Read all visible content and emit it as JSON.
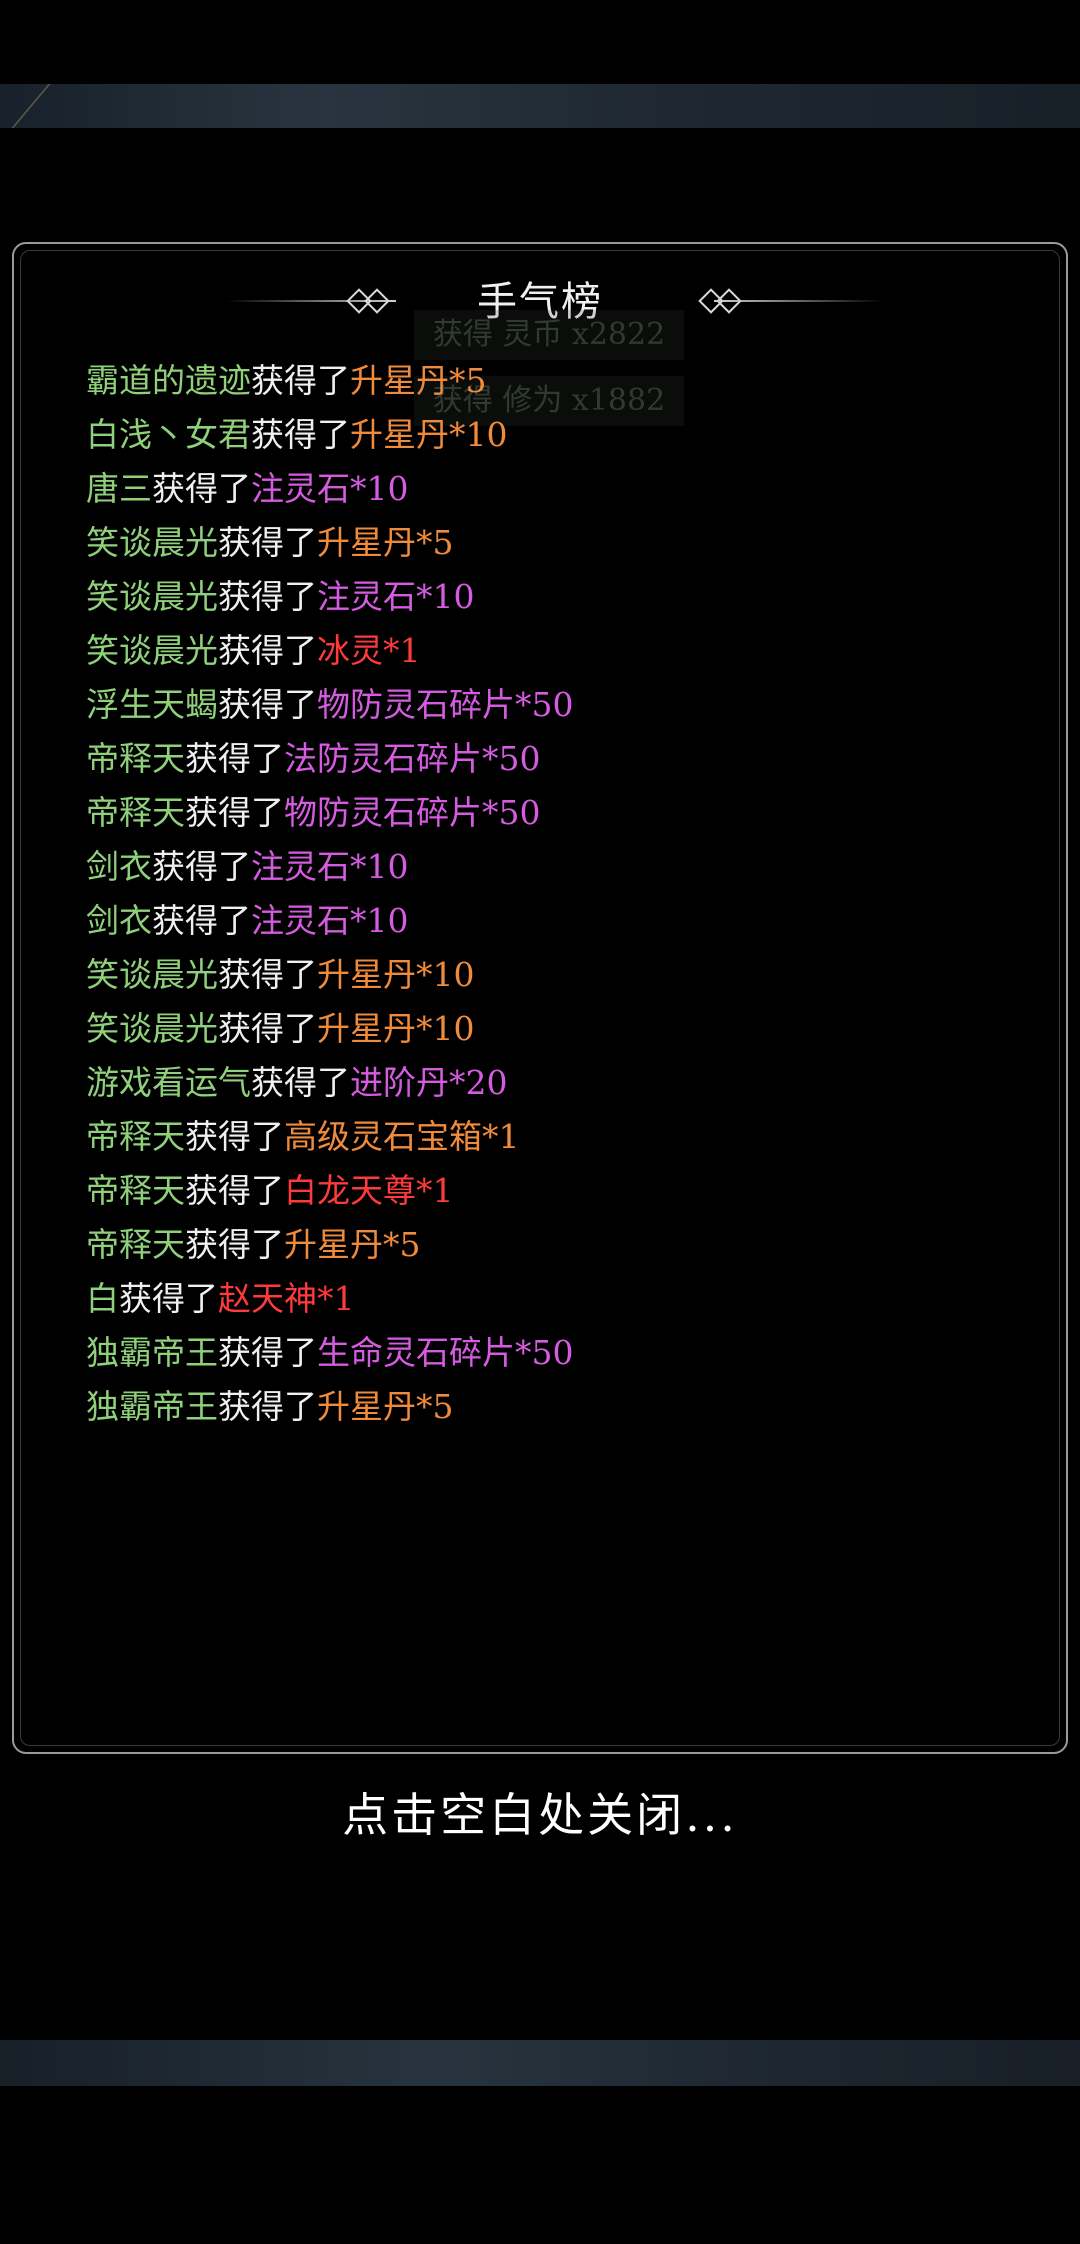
{
  "panel": {
    "title": "手气榜",
    "ghost_rows": [
      "获得 灵币 x2822",
      "获得 修为 x1882"
    ]
  },
  "colors": {
    "name": "#8fd07a",
    "verb": "#f0f0f0",
    "orange": "#f08b3c",
    "purple": "#d55ce0",
    "red": "#ff3a3a"
  },
  "records": [
    {
      "name": "霸道的遗迹",
      "verb": "获得了",
      "item": "升星丹*5",
      "color": "#f08b3c"
    },
    {
      "name": "白浅丶女君",
      "verb": "获得了",
      "item": "升星丹*10",
      "color": "#f08b3c"
    },
    {
      "name": "唐三",
      "verb": "获得了",
      "item": "注灵石*10",
      "color": "#d55ce0"
    },
    {
      "name": "笑谈晨光",
      "verb": "获得了",
      "item": "升星丹*5",
      "color": "#f08b3c"
    },
    {
      "name": "笑谈晨光",
      "verb": "获得了",
      "item": "注灵石*10",
      "color": "#d55ce0"
    },
    {
      "name": "笑谈晨光",
      "verb": "获得了",
      "item": "冰灵*1",
      "color": "#ff3a3a"
    },
    {
      "name": "浮生天蝎",
      "verb": "获得了",
      "item": "物防灵石碎片*50",
      "color": "#d55ce0"
    },
    {
      "name": "帝释天",
      "verb": "获得了",
      "item": "法防灵石碎片*50",
      "color": "#d55ce0"
    },
    {
      "name": "帝释天",
      "verb": "获得了",
      "item": "物防灵石碎片*50",
      "color": "#d55ce0"
    },
    {
      "name": "剑衣",
      "verb": "获得了",
      "item": "注灵石*10",
      "color": "#d55ce0"
    },
    {
      "name": "剑衣",
      "verb": "获得了",
      "item": "注灵石*10",
      "color": "#d55ce0"
    },
    {
      "name": "笑谈晨光",
      "verb": "获得了",
      "item": "升星丹*10",
      "color": "#f08b3c"
    },
    {
      "name": "笑谈晨光",
      "verb": "获得了",
      "item": "升星丹*10",
      "color": "#f08b3c"
    },
    {
      "name": "游戏看运气",
      "verb": "获得了",
      "item": "进阶丹*20",
      "color": "#d55ce0"
    },
    {
      "name": "帝释天",
      "verb": "获得了",
      "item": "高级灵石宝箱*1",
      "color": "#f08b3c"
    },
    {
      "name": "帝释天",
      "verb": "获得了",
      "item": "白龙天尊*1",
      "color": "#ff3a3a"
    },
    {
      "name": "帝释天",
      "verb": "获得了",
      "item": "升星丹*5",
      "color": "#f08b3c"
    },
    {
      "name": "白",
      "verb": "获得了",
      "item": "赵天神*1",
      "color": "#ff3a3a"
    },
    {
      "name": "独霸帝王",
      "verb": "获得了",
      "item": "生命灵石碎片*50",
      "color": "#d55ce0"
    },
    {
      "name": "独霸帝王",
      "verb": "获得了",
      "item": "升星丹*5",
      "color": "#f08b3c"
    }
  ],
  "footer": {
    "close_hint": "点击空白处关闭..."
  }
}
